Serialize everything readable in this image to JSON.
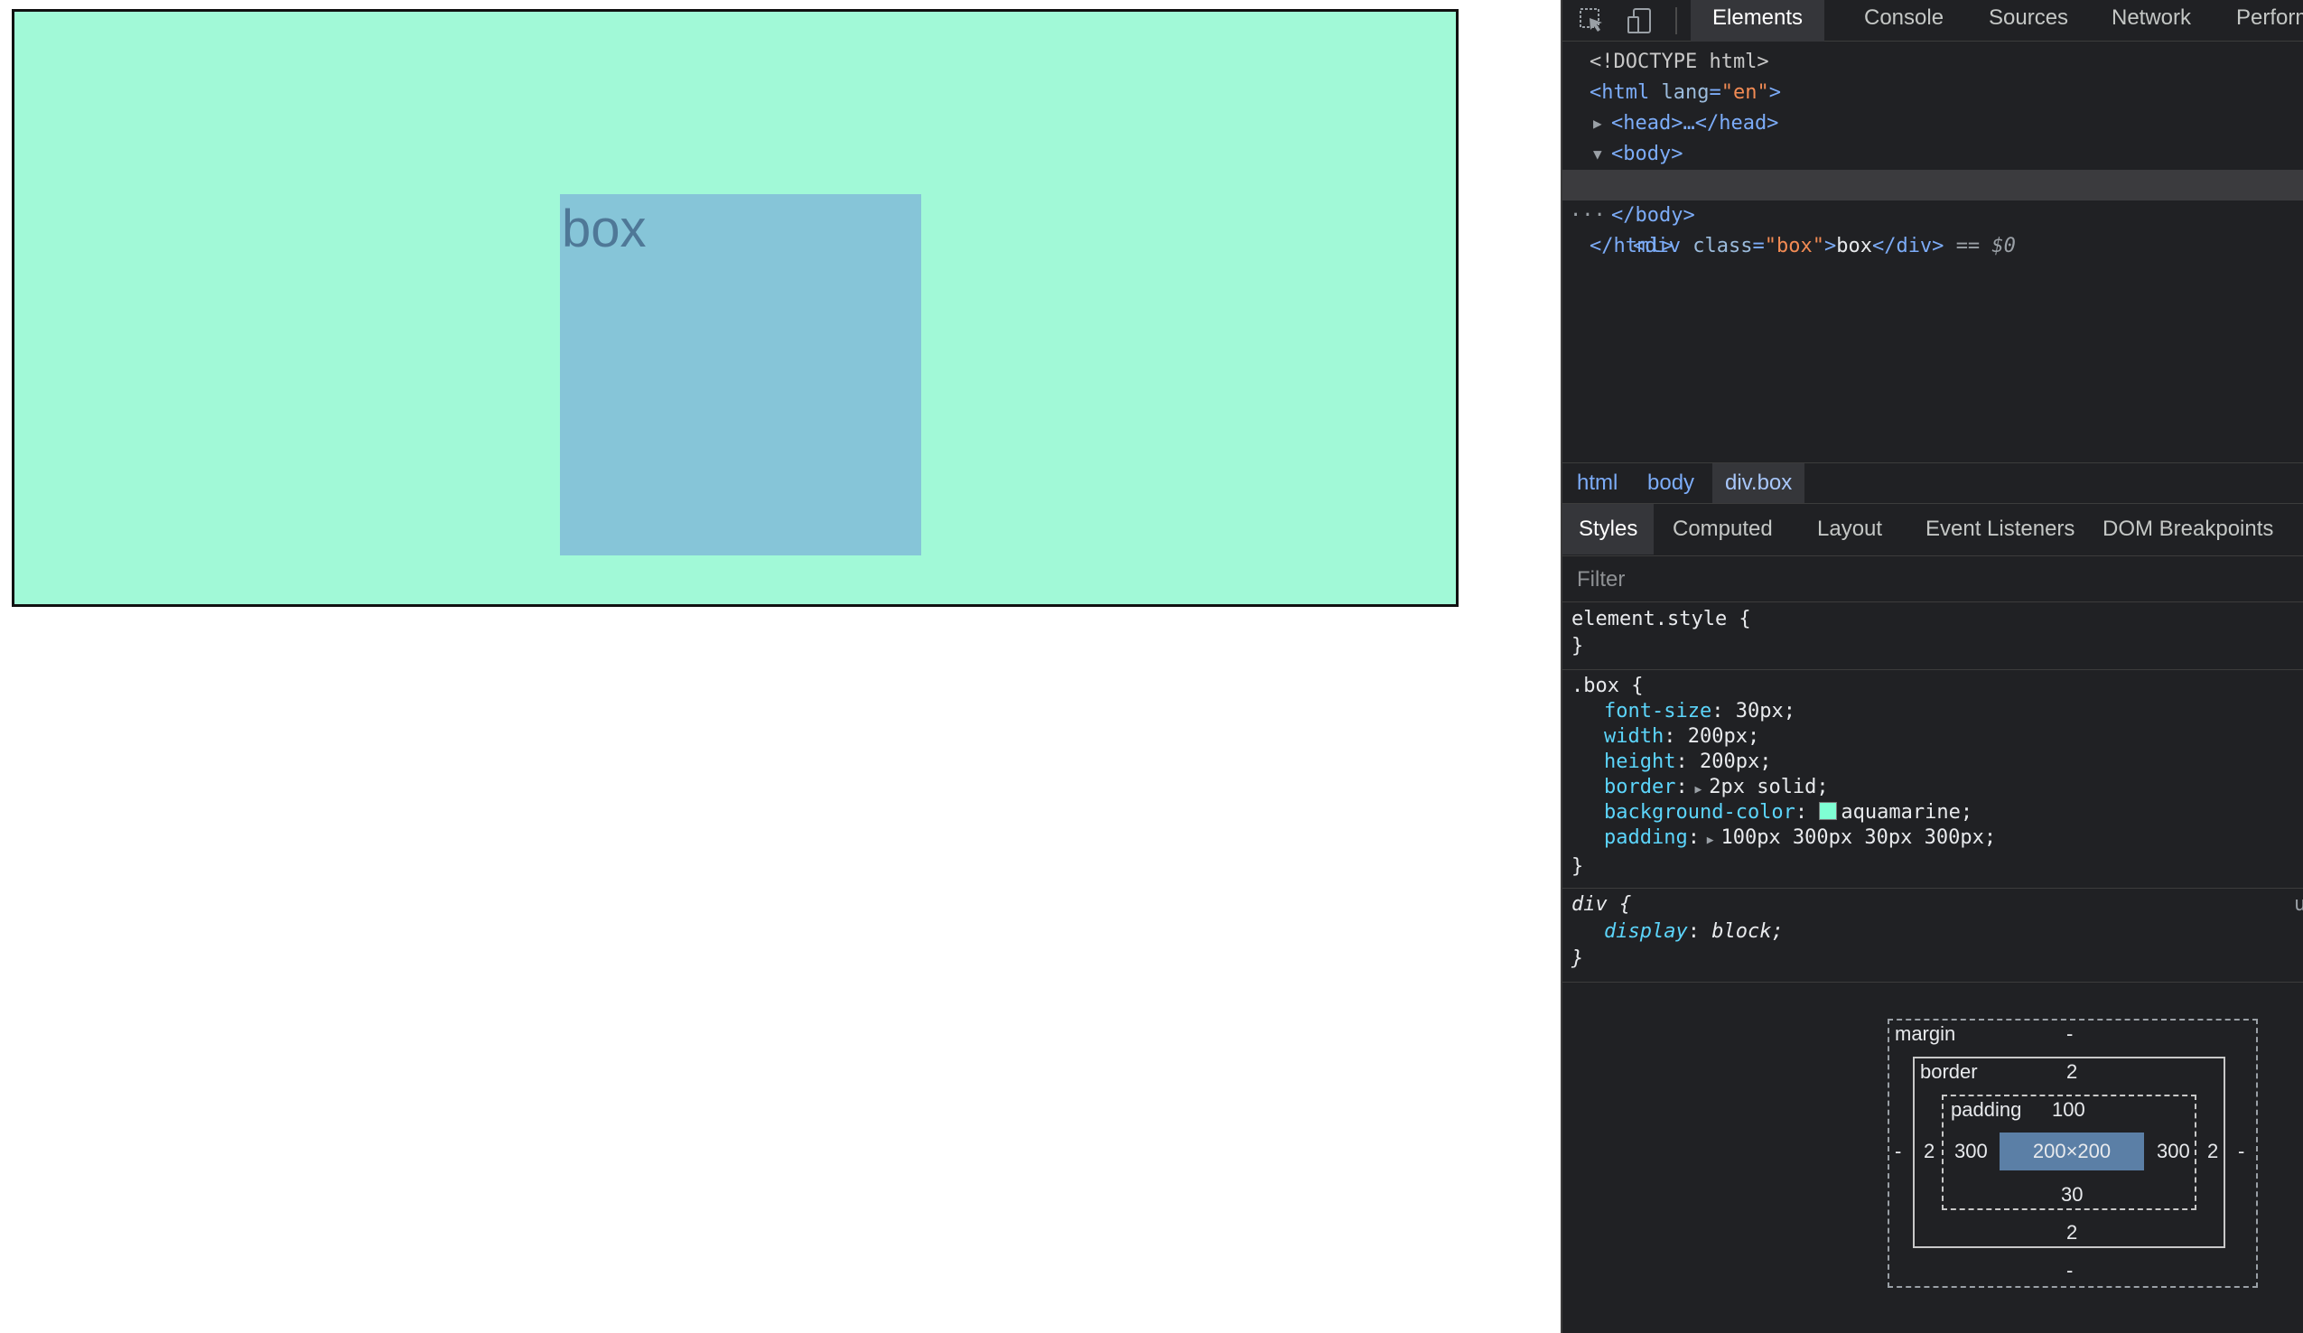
{
  "preview": {
    "box_text": "box",
    "colors": {
      "box_background": "#a1f9d7",
      "content_area": "#86c5d8",
      "box_text": "#4f7897"
    }
  },
  "devtools": {
    "toolbar": {
      "icons": [
        "inspect-element-icon",
        "device-toolbar-icon"
      ],
      "tabs": [
        "Elements",
        "Console",
        "Sources",
        "Network",
        "Performan"
      ],
      "active_tab": "Elements"
    },
    "dom": {
      "doctype": "<!DOCTYPE html>",
      "html_open": "<html",
      "lang_attr": "lang",
      "lang_val": "\"en\"",
      "html_close_bracket": ">",
      "head_collapsed": "<head>…</head>",
      "body_open": "<body>",
      "div_open": "<div",
      "class_attr": "class",
      "class_val": "\"box\"",
      "div_text": "box",
      "div_close": "</div>",
      "selected_marker": "== $0",
      "ellipsis": "···",
      "body_close": "</body>",
      "html_close": "</html>"
    },
    "breadcrumbs": [
      "html",
      "body",
      "div.box"
    ],
    "subtabs": [
      "Styles",
      "Computed",
      "Layout",
      "Event Listeners",
      "DOM Breakpoints"
    ],
    "filter_placeholder": "Filter",
    "styles": {
      "element_style": {
        "selector": "element.style {",
        "close": "}"
      },
      "box_rule": {
        "selector": ".box {",
        "close": "}",
        "declarations": [
          {
            "prop": "font-size",
            "value": "30px;"
          },
          {
            "prop": "width",
            "value": "200px;"
          },
          {
            "prop": "height",
            "value": "200px;"
          },
          {
            "prop": "border",
            "value": "2px solid;"
          },
          {
            "prop": "background-color",
            "value": "aquamarine;"
          },
          {
            "prop": "padding",
            "value": "100px 300px 30px 300px;"
          }
        ],
        "swatch_color": "#7fffd4"
      },
      "div_rule": {
        "selector": "div {",
        "close": "}",
        "declarations": [
          {
            "prop": "display",
            "value": "block;"
          }
        ],
        "source_hint": "u"
      }
    },
    "box_model": {
      "margin_label": "margin",
      "margin_top": "-",
      "margin_bottom": "-",
      "margin_left": "-",
      "margin_right": "-",
      "border_label": "border",
      "border_top": "2",
      "border_bottom": "2",
      "border_left": "2",
      "border_right": "2",
      "padding_label": "padding",
      "padding_top": "100",
      "padding_bottom": "30",
      "padding_left": "300",
      "padding_right": "300",
      "content": "200×200"
    }
  }
}
